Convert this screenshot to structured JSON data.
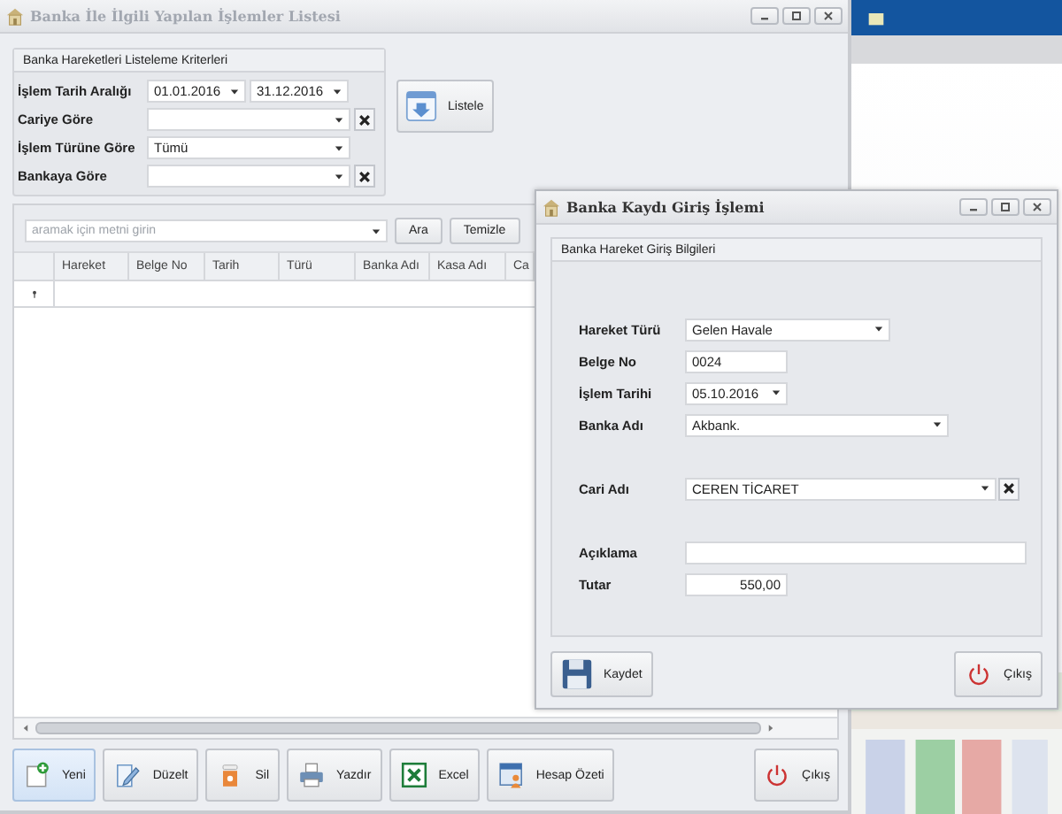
{
  "main_window": {
    "title": "Banka İle İlgili Yapılan İşlemler Listesi",
    "criteria": {
      "title": "Banka Hareketleri Listeleme Kriterleri",
      "rows": [
        {
          "label": "İşlem Tarih Aralığı",
          "kind": "date_range",
          "values": [
            "01.01.2016",
            "31.12.2016"
          ],
          "clearable": false
        },
        {
          "label": "Cariye Göre",
          "kind": "combo",
          "clearable": true
        },
        {
          "label": "İşlem Türüne Göre",
          "kind": "combo",
          "value": "Tümü",
          "clearable": false
        },
        {
          "label": "Bankaya Göre",
          "kind": "combo",
          "clearable": true
        }
      ]
    },
    "list_button": "Listele",
    "search": {
      "placeholder": "aramak için metni girin"
    },
    "search_buttons": [
      "Ara",
      "Temizle"
    ],
    "table": {
      "columns": [
        "Hareket",
        "Belge No",
        "Tarih",
        "Türü",
        "Banka Adı",
        "Kasa Adı",
        "Ca"
      ]
    },
    "toolbar": [
      {
        "label": "Yeni",
        "kind": "new",
        "focused": true
      },
      {
        "label": "Düzelt",
        "kind": "edit",
        "focused": false
      },
      {
        "label": "Sil",
        "kind": "delete",
        "focused": false
      },
      {
        "label": "Yazdır",
        "kind": "print",
        "focused": false
      },
      {
        "label": "Excel",
        "kind": "excel",
        "focused": false
      },
      {
        "label": "Hesap Özeti",
        "kind": "statement",
        "focused": false
      }
    ],
    "exit_button": "Çıkış"
  },
  "dialog": {
    "title": "Banka Kaydı Giriş İşlemi",
    "group_title": "Banka Hareket Giriş Bilgileri",
    "field_groups": [
      [
        {
          "label": "Hareket Türü",
          "kind": "combo",
          "value": "Gelen Havale",
          "clearable": false
        },
        {
          "label": "Belge No",
          "kind": "text",
          "value": "0024",
          "clearable": false
        },
        {
          "label": "İşlem Tarihi",
          "kind": "date",
          "value": "05.10.2016",
          "clearable": false
        },
        {
          "label": "Banka Adı",
          "kind": "combo",
          "value": "Akbank.",
          "clearable": false
        }
      ],
      [
        {
          "label": "Cari Adı",
          "kind": "combo",
          "value": "CEREN TİCARET",
          "clearable": true
        }
      ],
      [
        {
          "label": "Açıklama",
          "kind": "text",
          "clearable": false
        },
        {
          "label": "Tutar",
          "kind": "number",
          "value": "550,00",
          "clearable": false
        }
      ]
    ],
    "buttons": [
      {
        "label": "Kaydet",
        "kind": "save"
      },
      {
        "label": "Çıkış",
        "kind": "exit"
      }
    ]
  }
}
